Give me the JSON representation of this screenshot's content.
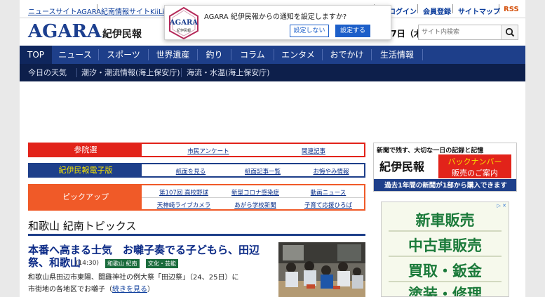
{
  "util": {
    "site1": "ニュースサイトAGARA",
    "site2": "紀南情報サイトKiiLife",
    "login": "ログイン",
    "register": "会員登録",
    "sitemap": "サイトマップ",
    "rss": "RSS"
  },
  "header": {
    "logo": "AGARA",
    "logo_sub": "紀伊民報",
    "date": "月17日（木）",
    "search_placeholder": "サイト内検索"
  },
  "notification": {
    "seal_text": "AGARA",
    "seal_sub": "紀伊民報",
    "message": "AGARA 紀伊民報からの通知を設定しますか?",
    "decline": "設定しない",
    "accept": "設定する"
  },
  "nav": [
    "TOP",
    "ニュース",
    "スポーツ",
    "世界遺産",
    "釣り",
    "コラム",
    "エンタメ",
    "おでかけ",
    "生活情報"
  ],
  "subnav": [
    "今日の天気",
    "潮汐・潮流情報(海上保安庁)",
    "海流・水温(海上保安庁)"
  ],
  "boxes": {
    "election": {
      "title": "参院選",
      "links": [
        "市民アンケート",
        "関連記事"
      ],
      "color": "#e2231a"
    },
    "paper": {
      "title": "紀伊民報電子版",
      "links": [
        "紙面を見る",
        "紙面記事一覧",
        "お悔やみ情報"
      ],
      "color": "#1e3f8a"
    },
    "pickup": {
      "title": "ピックアップ",
      "links": [
        "第107回 高校野球",
        "新型コロナ感染症",
        "動画ニュース",
        "天神崎ライブカメラ",
        "あがら学校新聞",
        "子育て応援ひろば"
      ],
      "color": "#f05a28"
    }
  },
  "ad1": {
    "line1": "新聞で残す、大切な一日の記録と記憶",
    "brand": "紀伊民報",
    "badge1": "バックナンバー",
    "badge2": "販売のご案内",
    "footer": "過去1年間の新聞が1部から購入できます"
  },
  "ad2": {
    "lines": [
      "新車販売",
      "中古車販売",
      "買取・鈑金",
      "塗装・修理"
    ]
  },
  "topics": {
    "section_title": "和歌山 紀南トピックス",
    "headline_line1": "本番へ高まる士気　お囃子奏でる子どもら、田辺",
    "headline_line2": "祭、和歌山",
    "time": "(14:30)",
    "tag1": "和歌山 紀南",
    "tag2": "文化・芸能",
    "body_line1": "和歌山県田辺市東陽、闘雞神社の例大祭「田辺祭」（24、25日）に",
    "body_line2": "市街地の各地区でお囃子（",
    "more": "続きを見る",
    "more_suffix": "）"
  },
  "colors": {
    "brand_blue": "#1e3f8a",
    "nav_dark": "#0d1f4b",
    "link_blue": "#0b3c9b",
    "election_red": "#e2231a",
    "pickup_orange": "#f05a28"
  }
}
